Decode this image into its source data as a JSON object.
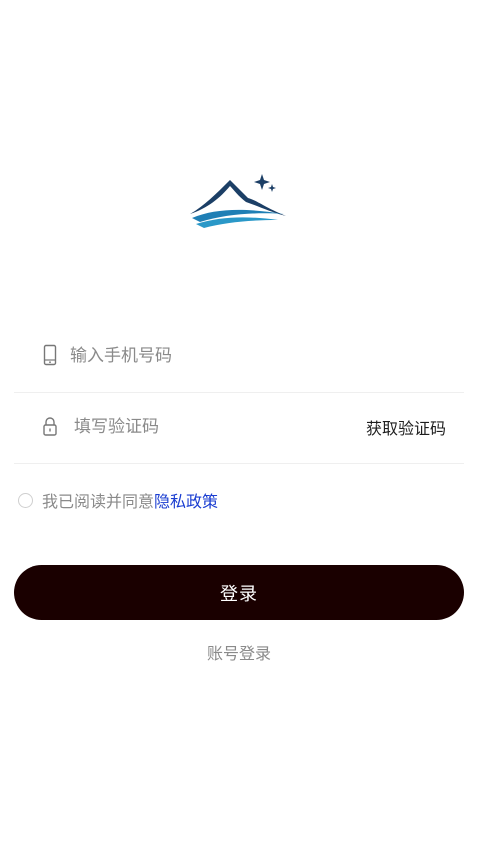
{
  "login": {
    "phone_placeholder": "输入手机号码",
    "code_placeholder": "填写验证码",
    "get_code_label": "获取验证码",
    "agreement_text": "我已阅读并同意",
    "privacy_link": "隐私政策",
    "login_button": "登录",
    "account_login_link": "账号登录"
  },
  "colors": {
    "primary_button": "#1a0000",
    "link": "#1a3dd1",
    "logo_blue": "#1f7fb5",
    "logo_navy": "#1c3f66"
  },
  "icons": {
    "logo": "mountain-stars-logo",
    "phone": "phone-icon",
    "lock": "lock-icon",
    "agreement_checkbox": "radio-circle"
  }
}
